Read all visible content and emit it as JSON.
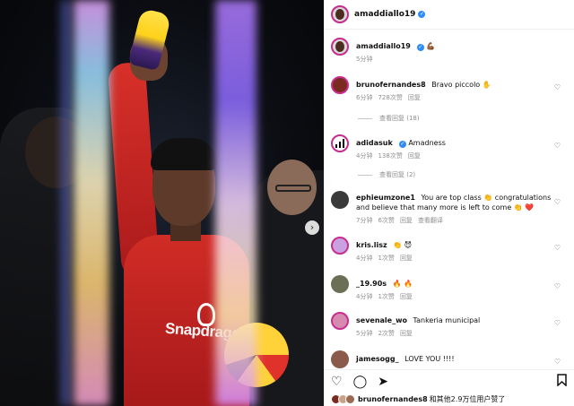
{
  "post": {
    "author": "amaddiallo19",
    "caption_emoji": "💪🏾",
    "caption_time": "5分钟",
    "shirt_sponsor": "Snapdragon"
  },
  "comments": [
    {
      "user": "brunofernandes8",
      "text": "Bravo piccolo ✋",
      "time": "6分钟",
      "likes": "728次赞",
      "reply": "回复",
      "view_replies": "查看回复 (18)",
      "avatar_color": "#7a2a1e"
    },
    {
      "user": "adidasuk",
      "verified": true,
      "text": "Amadness",
      "time": "4分钟",
      "likes": "138次赞",
      "reply": "回复",
      "view_replies": "查看回复 (2)",
      "avatar_color": "#111111"
    },
    {
      "user": "ephieumzone1",
      "text": "You are top class 👏 congratulations and believe that many more is left to come 👏 ❤️",
      "time": "7分钟",
      "likes": "6次赞",
      "reply": "回复",
      "extra": "查看翻译",
      "avatar_color": "#3a3a3a"
    },
    {
      "user": "kris.lisz",
      "text": "👏 😈",
      "time": "4分钟",
      "likes": "1次赞",
      "reply": "回复",
      "avatar_color": "#c9a0e0"
    },
    {
      "user": "_19.90s",
      "text": "🔥 🔥",
      "time": "4分钟",
      "likes": "1次赞",
      "reply": "回复",
      "avatar_color": "#6a6f55"
    },
    {
      "user": "sevenale_wo",
      "text": "Tankeria municipal",
      "time": "5分钟",
      "likes": "2次赞",
      "reply": "回复",
      "avatar_color": "#d68ab0"
    },
    {
      "user": "jamesogg_",
      "text": "LOVE YOU !!!!",
      "avatar_color": "#8a5a4a"
    }
  ],
  "likes_line": {
    "user": "brunofernandes8",
    "text": "和其他2.9万位用户赞了"
  },
  "icons": [
    "heart-icon",
    "comment-icon",
    "share-icon",
    "bookmark-icon",
    "chevron-right-icon",
    "verified-badge-icon"
  ],
  "colors": {
    "verified": "#2f8cf5",
    "story_ring": "#c72e8f",
    "jersey": "#d12c26"
  }
}
